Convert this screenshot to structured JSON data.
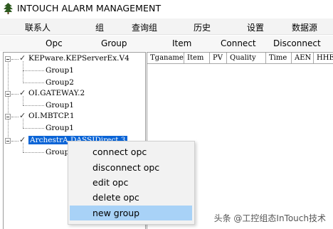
{
  "window": {
    "title": "INTOUCH ALARM MANAGEMENT"
  },
  "menu": [
    "联系人",
    "组",
    "查询组",
    "历史",
    "设置",
    "数据源"
  ],
  "toolbar": [
    "Opc",
    "Group",
    "Item",
    "Connect",
    "Disconnect"
  ],
  "tree": [
    {
      "label": "KEPware.KEPServerEx.V4",
      "children": [
        "Group1",
        "Group2"
      ]
    },
    {
      "label": "OI.GATEWAY.2",
      "children": [
        "Group1"
      ]
    },
    {
      "label": "OI.MBTCP.1",
      "children": [
        "Group1"
      ]
    },
    {
      "label": "ArchestrA.DASSIDirect.3",
      "children": [
        "Group"
      ],
      "selected": true
    }
  ],
  "table": {
    "columns": [
      "Tganame",
      "Item",
      "PV",
      "Quality",
      "Time",
      "AEN",
      "HHEN"
    ]
  },
  "context_menu": {
    "items": [
      "connect opc",
      "disconnect opc",
      "edit opc",
      "delete opc",
      "new group"
    ],
    "highlighted": "new group"
  },
  "watermark": "头条 @工控组态InTouch技术"
}
